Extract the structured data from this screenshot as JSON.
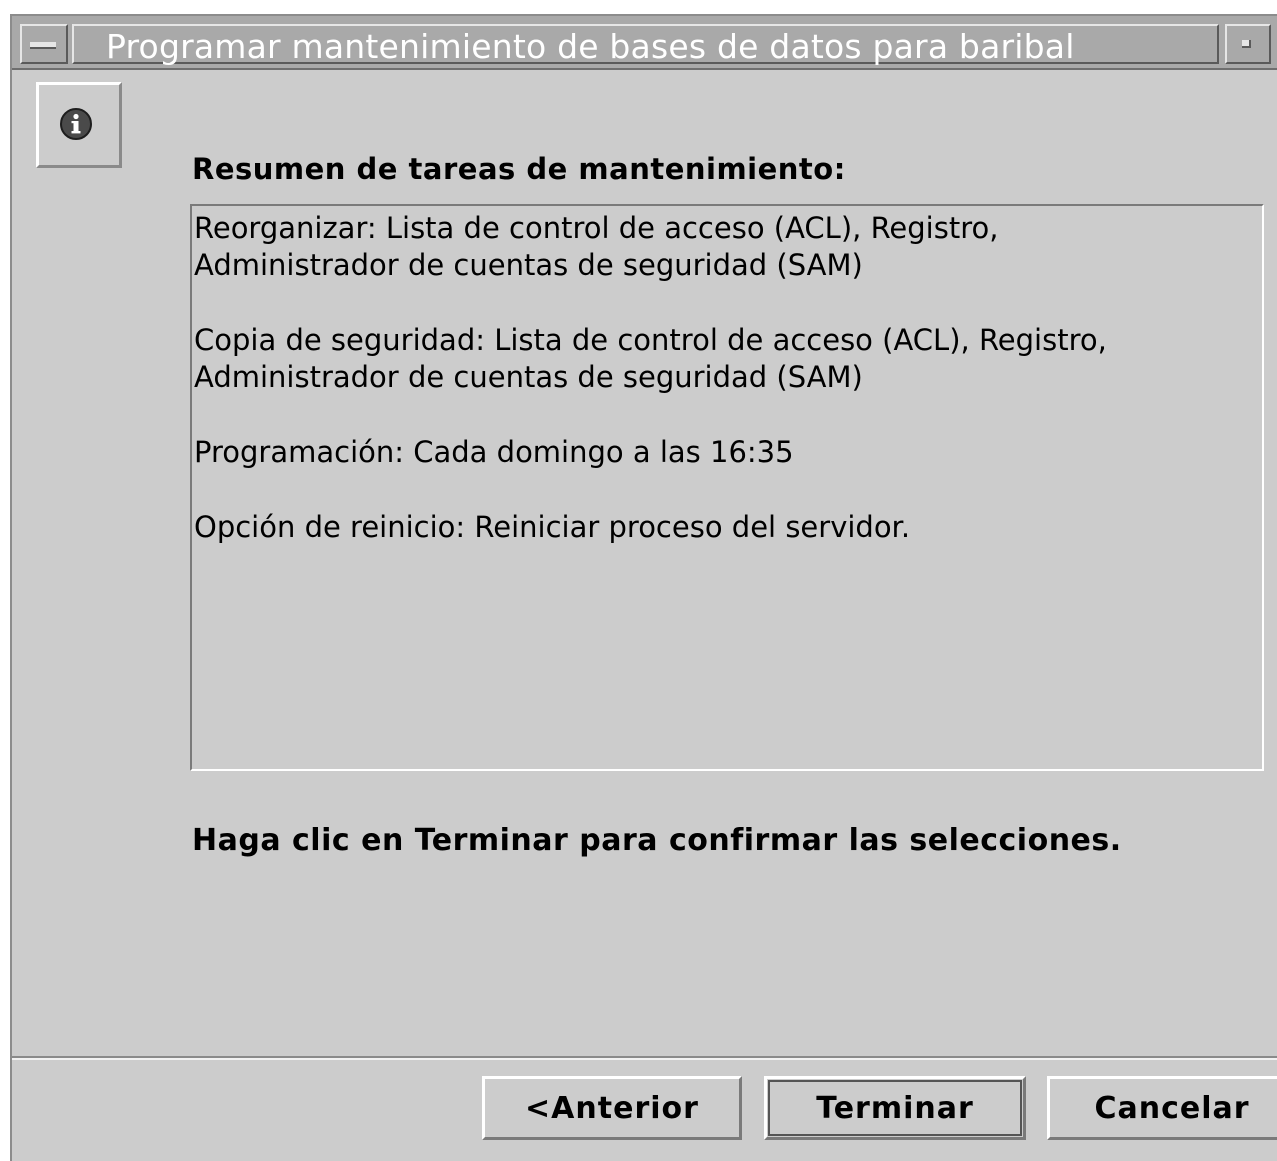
{
  "window": {
    "title": "Programar mantenimiento de bases de datos para baribal"
  },
  "icons": {
    "window_menu": "window-menu-icon",
    "minimize": "minimize-icon",
    "info": "info-icon"
  },
  "main": {
    "heading": "Resumen de tareas de mantenimiento:",
    "summary": [
      "Reorganizar: Lista de control de acceso (ACL), Registro,\nAdministrador de cuentas de seguridad (SAM)",
      "Copia de seguridad: Lista de control de acceso (ACL), Registro,\nAdministrador de cuentas de seguridad (SAM)",
      "Programación: Cada domingo a las 16:35",
      "Opción de reinicio: Reiniciar proceso del servidor."
    ],
    "confirm_text": "Haga clic en Terminar para confirmar las selecciones."
  },
  "buttons": {
    "previous": "<Anterior",
    "finish": "Terminar",
    "cancel": "Cancelar"
  }
}
